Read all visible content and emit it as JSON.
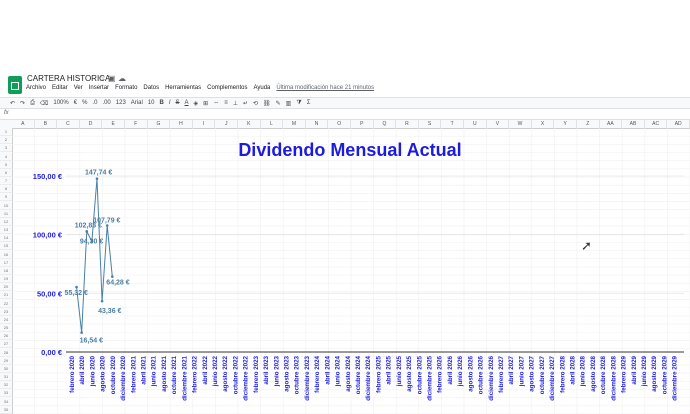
{
  "app": {
    "doc_title": "CARTERA HISTORICA",
    "menu": [
      "Archivo",
      "Editar",
      "Ver",
      "Insertar",
      "Formato",
      "Datos",
      "Herramientas",
      "Complementos",
      "Ayuda"
    ],
    "last_modified": "Última modificación hace 21 minutos"
  },
  "toolbar": {
    "zoom": "100%",
    "currency": "€",
    "percent": "%",
    "decimals_less": ".0",
    "decimals_more": ".00",
    "format_more": "123",
    "font": "Arial",
    "font_size": "10",
    "bold": "B",
    "italic": "I",
    "strike": "S",
    "text_color": "A",
    "sum": "Σ"
  },
  "formula_bar": {
    "fx": "fx"
  },
  "columns": [
    "A",
    "B",
    "C",
    "D",
    "E",
    "F",
    "G",
    "H",
    "I",
    "J",
    "K",
    "L",
    "M",
    "N",
    "O",
    "P",
    "Q",
    "R",
    "S",
    "T",
    "U",
    "V",
    "W",
    "X",
    "Y",
    "Z",
    "AA",
    "AB",
    "AC",
    "AD"
  ],
  "rows": [
    "1",
    "2",
    "3",
    "4",
    "5",
    "6",
    "7",
    "8",
    "9",
    "10",
    "11",
    "12",
    "13",
    "14",
    "15",
    "16",
    "17",
    "18",
    "19",
    "20",
    "21",
    "22",
    "23",
    "24",
    "25",
    "26",
    "27",
    "28",
    "29",
    "30",
    "31",
    "32",
    "33",
    "34",
    "35"
  ],
  "colors": {
    "accent": "#1c1ce0",
    "series": "#4a7fa6",
    "grid": "#e6e6e6"
  },
  "chart_data": {
    "type": "line",
    "title": "Dividendo Mensual Actual",
    "ylim": [
      0,
      150
    ],
    "y_ticks": [
      "0,00 €",
      "50,00 €",
      "100,00 €",
      "150,00 €"
    ],
    "y_tick_values": [
      0,
      50,
      100,
      150
    ],
    "categories": [
      "febrero 2020",
      "abril 2020",
      "junio 2020",
      "agosto 2020",
      "octubre 2020",
      "diciembre 2020",
      "febrero 2021",
      "abril 2021",
      "junio 2021",
      "agosto 2021",
      "octubre 2021",
      "diciembre 2021",
      "febrero 2022",
      "abril 2022",
      "junio 2022",
      "agosto 2022",
      "octubre 2022",
      "diciembre 2022",
      "febrero 2023",
      "abril 2023",
      "junio 2023",
      "agosto 2023",
      "octubre 2023",
      "diciembre 2023",
      "febrero 2024",
      "abril 2024",
      "junio 2024",
      "agosto 2024",
      "octubre 2024",
      "diciembre 2024",
      "febrero 2025",
      "abril 2025",
      "junio 2025",
      "agosto 2025",
      "octubre 2025",
      "diciembre 2025",
      "febrero 2026",
      "abril 2026",
      "junio 2026",
      "agosto 2026",
      "octubre 2026",
      "diciembre 2026",
      "febrero 2027",
      "abril 2027",
      "junio 2027",
      "agosto 2027",
      "octubre 2027",
      "diciembre 2027",
      "febrero 2028",
      "abril 2028",
      "junio 2028",
      "agosto 2028",
      "octubre 2028",
      "diciembre 2028",
      "febrero 2029",
      "abril 2029",
      "junio 2029",
      "agosto 2029",
      "octubre 2029",
      "diciembre 2029"
    ],
    "series": [
      {
        "months_index": [
          0,
          1,
          2,
          3,
          4,
          5,
          6,
          7,
          8,
          9
        ],
        "values": [
          55.32,
          16.54,
          102.83,
          94.3,
          147.74,
          43.36,
          107.79,
          64.28
        ],
        "labels": [
          "55,32 €",
          "16,54 €",
          "102,83 €",
          "94,30 €",
          "147,74 €",
          "43,36 €",
          "107,79 €",
          "64,28 €"
        ],
        "grid": true
      }
    ]
  }
}
